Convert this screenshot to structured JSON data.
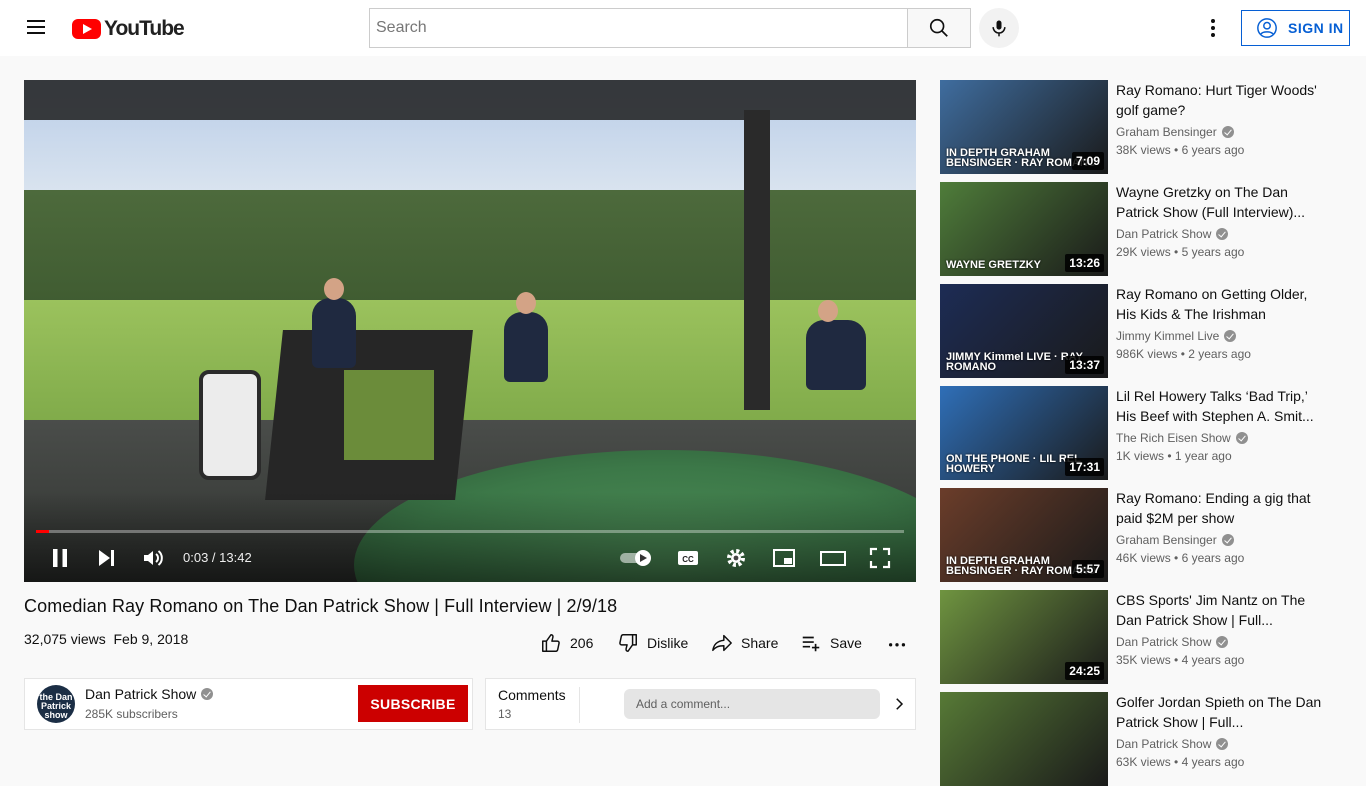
{
  "header": {
    "logo_text": "YouTube",
    "search_placeholder": "Search",
    "sign_in_label": "SIGN IN"
  },
  "player": {
    "time_display": "0:03 / 13:42",
    "progress_percent": 1.5
  },
  "video": {
    "title": "Comedian Ray Romano on The Dan Patrick Show | Full Interview | 2/9/18",
    "views": "32,075 views",
    "date": "Feb 9, 2018",
    "likes": "206",
    "dislike_label": "Dislike",
    "share_label": "Share",
    "save_label": "Save"
  },
  "channel": {
    "name": "Dan Patrick Show",
    "subscribers": "285K subscribers",
    "subscribe_label": "SUBSCRIBE",
    "avatar_text": "the Dan Patrick show"
  },
  "comments": {
    "title": "Comments",
    "count": "13",
    "placeholder": "Add a comment..."
  },
  "recommendations": [
    {
      "title": "Ray Romano: Hurt Tiger Woods' golf game?",
      "channel": "Graham Bensinger",
      "views": "38K views",
      "age": "6 years ago",
      "duration": "7:09",
      "thumb_color": "#3f6d9f",
      "overlay": "IN DEPTH GRAHAM BENSINGER · RAY ROMANO"
    },
    {
      "title": "Wayne Gretzky on The Dan Patrick Show (Full Interview)...",
      "channel": "Dan Patrick Show",
      "views": "29K views",
      "age": "5 years ago",
      "duration": "13:26",
      "thumb_color": "#4f7d3a",
      "overlay": "WAYNE GRETZKY"
    },
    {
      "title": "Ray Romano on Getting Older, His Kids & The Irishman",
      "channel": "Jimmy Kimmel Live",
      "views": "986K views",
      "age": "2 years ago",
      "duration": "13:37",
      "thumb_color": "#1d2c55",
      "overlay": "JIMMY Kimmel LIVE · RAY ROMANO"
    },
    {
      "title": "Lil Rel Howery Talks ‘Bad Trip,’ His Beef with Stephen A. Smit...",
      "channel": "The Rich Eisen Show",
      "views": "1K views",
      "age": "1 year ago",
      "duration": "17:31",
      "thumb_color": "#2f6fb8",
      "overlay": "ON THE PHONE · LIL REL HOWERY"
    },
    {
      "title": "Ray Romano: Ending a gig that paid $2M per show",
      "channel": "Graham Bensinger",
      "views": "46K views",
      "age": "6 years ago",
      "duration": "5:57",
      "thumb_color": "#6b3d2a",
      "overlay": "IN DEPTH GRAHAM BENSINGER · RAY ROMANO"
    },
    {
      "title": "CBS Sports' Jim Nantz on The Dan Patrick Show | Full...",
      "channel": "Dan Patrick Show",
      "views": "35K views",
      "age": "4 years ago",
      "duration": "24:25",
      "thumb_color": "#6f9440",
      "overlay": ""
    },
    {
      "title": "Golfer Jordan Spieth on The Dan Patrick Show | Full...",
      "channel": "Dan Patrick Show",
      "views": "63K views",
      "age": "4 years ago",
      "duration": "",
      "thumb_color": "#577a36",
      "overlay": ""
    }
  ]
}
